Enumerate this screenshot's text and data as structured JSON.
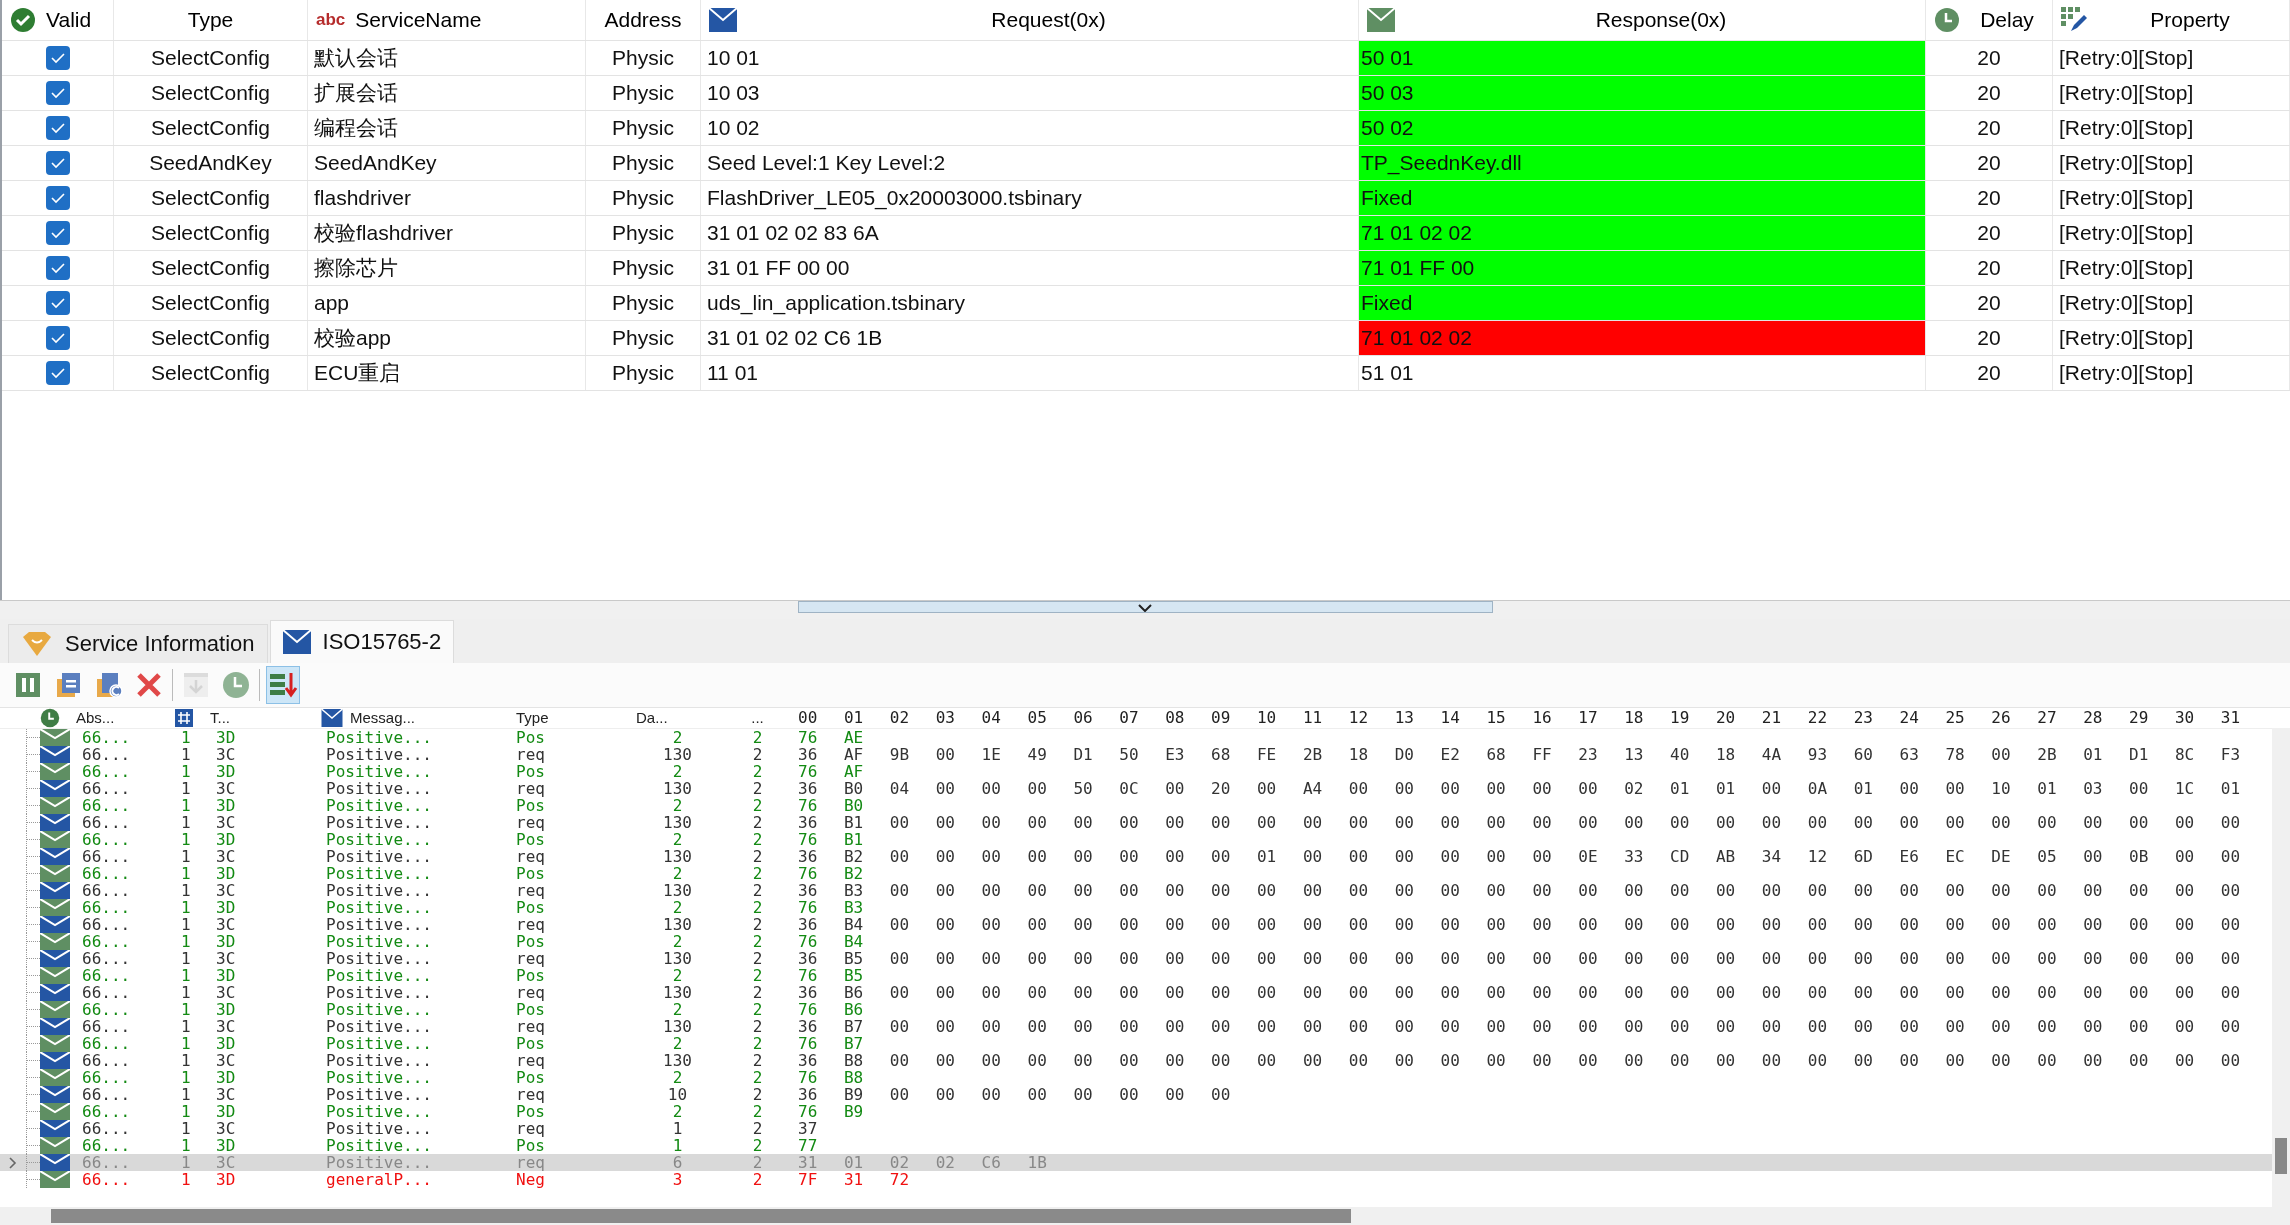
{
  "services": {
    "columns": [
      {
        "kind": "valid",
        "label": "Valid"
      },
      {
        "kind": "type",
        "label": "Type"
      },
      {
        "kind": "name",
        "label": "ServiceName",
        "icon_text": "abc"
      },
      {
        "kind": "address",
        "label": "Address"
      },
      {
        "kind": "request",
        "label": "Request(0x)"
      },
      {
        "kind": "response",
        "label": "Response(0x)"
      },
      {
        "kind": "delay",
        "label": "Delay"
      },
      {
        "kind": "property",
        "label": "Property"
      }
    ],
    "rows": [
      {
        "checked": true,
        "type": "SelectConfig",
        "name": "默认会话",
        "address": "Physic",
        "request": "10 01",
        "response": "50 01",
        "color": "#00ff00",
        "delay": "20",
        "property": "[Retry:0][Stop]"
      },
      {
        "checked": true,
        "type": "SelectConfig",
        "name": "扩展会话",
        "address": "Physic",
        "request": "10 03",
        "response": "50 03",
        "color": "#00ff00",
        "delay": "20",
        "property": "[Retry:0][Stop]"
      },
      {
        "checked": true,
        "type": "SelectConfig",
        "name": "编程会话",
        "address": "Physic",
        "request": "10 02",
        "response": "50 02",
        "color": "#00ff00",
        "delay": "20",
        "property": "[Retry:0][Stop]"
      },
      {
        "checked": true,
        "type": "SeedAndKey",
        "name": "SeedAndKey",
        "address": "Physic",
        "request": "Seed Level:1 Key Level:2",
        "response": "TP_SeednKey.dll",
        "color": "#00ff00",
        "delay": "20",
        "property": "[Retry:0][Stop]"
      },
      {
        "checked": true,
        "type": "SelectConfig",
        "name": "flashdriver",
        "address": "Physic",
        "request": "FlashDriver_LE05_0x20003000.tsbinary",
        "response": "Fixed",
        "color": "#00ff00",
        "delay": "20",
        "property": "[Retry:0][Stop]"
      },
      {
        "checked": true,
        "type": "SelectConfig",
        "name": "校验flashdriver",
        "address": "Physic",
        "request": "31 01 02 02 83 6A",
        "response": "71 01 02 02",
        "color": "#00ff00",
        "delay": "20",
        "property": "[Retry:0][Stop]"
      },
      {
        "checked": true,
        "type": "SelectConfig",
        "name": "擦除芯片",
        "address": "Physic",
        "request": "31 01 FF 00 00",
        "response": "71 01 FF 00",
        "color": "#00ff00",
        "delay": "20",
        "property": "[Retry:0][Stop]"
      },
      {
        "checked": true,
        "type": "SelectConfig",
        "name": "app",
        "address": "Physic",
        "request": "uds_lin_application.tsbinary",
        "response": "Fixed",
        "color": "#00ff00",
        "delay": "20",
        "property": "[Retry:0][Stop]"
      },
      {
        "checked": true,
        "type": "SelectConfig",
        "name": "校验app",
        "address": "Physic",
        "request": "31 01 02 02 C6 1B",
        "response": "71 01 02 02",
        "color": "#ff0000",
        "delay": "20",
        "property": "[Retry:0][Stop]"
      },
      {
        "checked": true,
        "type": "SelectConfig",
        "name": "ECU重启",
        "address": "Physic",
        "request": "11 01",
        "response": "51 01",
        "delay": "20",
        "property": "[Retry:0][Stop]"
      }
    ]
  },
  "tabs": [
    {
      "kind": "service",
      "label": "Service Information",
      "selected": false
    },
    {
      "kind": "protocol",
      "label": "ISO15765-2",
      "selected": true
    }
  ],
  "toolbar": [
    {
      "kind": "pause",
      "disabled": false,
      "on": false
    },
    {
      "kind": "copy",
      "disabled": false,
      "on": false
    },
    {
      "kind": "copy-c",
      "disabled": false,
      "on": false
    },
    {
      "kind": "delete",
      "disabled": false,
      "on": false
    },
    {
      "kind": "export",
      "disabled": true,
      "on": false
    },
    {
      "kind": "clock",
      "disabled": false,
      "on": false
    },
    {
      "kind": "autoscroll",
      "disabled": false,
      "on": true
    }
  ],
  "log": {
    "columns": [
      {
        "label": "Abs..."
      },
      {
        "label": "T..."
      },
      {
        "label": "Messag..."
      },
      {
        "label": "Type"
      },
      {
        "label": "Da..."
      },
      {
        "label": "..."
      },
      {
        "label": "00 01 02 03 04 05 06 07 08 09 10 11 12 13 14 15 16 17 18 19 20 21 22 23 24 25 26 27 28 29 30 31"
      }
    ],
    "rows": [
      {
        "kind": "pos",
        "selected": false,
        "abs": "66...",
        "ch": "1",
        "id": "3D",
        "msg": "Positive...",
        "type": "Pos",
        "dlc": "2",
        "len": "2",
        "data": "76 AE"
      },
      {
        "kind": "req",
        "selected": false,
        "abs": "66...",
        "ch": "1",
        "id": "3C",
        "msg": "Positive...",
        "type": "req",
        "dlc": "130",
        "len": "2",
        "data": "36 AF 9B 00 1E 49 D1 50 E3 68 FE 2B 18 D0 E2 68 FF 23 13 40 18 4A 93 60 63 78 00 2B 01 D1 8C F3"
      },
      {
        "kind": "pos",
        "selected": false,
        "abs": "66...",
        "ch": "1",
        "id": "3D",
        "msg": "Positive...",
        "type": "Pos",
        "dlc": "2",
        "len": "2",
        "data": "76 AF"
      },
      {
        "kind": "req",
        "selected": false,
        "abs": "66...",
        "ch": "1",
        "id": "3C",
        "msg": "Positive...",
        "type": "req",
        "dlc": "130",
        "len": "2",
        "data": "36 B0 04 00 00 00 50 0C 00 20 00 A4 00 00 00 00 00 00 02 01 01 00 0A 01 00 00 10 01 03 00 1C 01"
      },
      {
        "kind": "pos",
        "selected": false,
        "abs": "66...",
        "ch": "1",
        "id": "3D",
        "msg": "Positive...",
        "type": "Pos",
        "dlc": "2",
        "len": "2",
        "data": "76 B0"
      },
      {
        "kind": "req",
        "selected": false,
        "abs": "66...",
        "ch": "1",
        "id": "3C",
        "msg": "Positive...",
        "type": "req",
        "dlc": "130",
        "len": "2",
        "data": "36 B1 00 00 00 00 00 00 00 00 00 00 00 00 00 00 00 00 00 00 00 00 00 00 00 00 00 00 00 00 00 00"
      },
      {
        "kind": "pos",
        "selected": false,
        "abs": "66...",
        "ch": "1",
        "id": "3D",
        "msg": "Positive...",
        "type": "Pos",
        "dlc": "2",
        "len": "2",
        "data": "76 B1"
      },
      {
        "kind": "req",
        "selected": false,
        "abs": "66...",
        "ch": "1",
        "id": "3C",
        "msg": "Positive...",
        "type": "req",
        "dlc": "130",
        "len": "2",
        "data": "36 B2 00 00 00 00 00 00 00 00 01 00 00 00 00 00 00 0E 33 CD AB 34 12 6D E6 EC DE 05 00 0B 00 00"
      },
      {
        "kind": "pos",
        "selected": false,
        "abs": "66...",
        "ch": "1",
        "id": "3D",
        "msg": "Positive...",
        "type": "Pos",
        "dlc": "2",
        "len": "2",
        "data": "76 B2"
      },
      {
        "kind": "req",
        "selected": false,
        "abs": "66...",
        "ch": "1",
        "id": "3C",
        "msg": "Positive...",
        "type": "req",
        "dlc": "130",
        "len": "2",
        "data": "36 B3 00 00 00 00 00 00 00 00 00 00 00 00 00 00 00 00 00 00 00 00 00 00 00 00 00 00 00 00 00 00"
      },
      {
        "kind": "pos",
        "selected": false,
        "abs": "66...",
        "ch": "1",
        "id": "3D",
        "msg": "Positive...",
        "type": "Pos",
        "dlc": "2",
        "len": "2",
        "data": "76 B3"
      },
      {
        "kind": "req",
        "selected": false,
        "abs": "66...",
        "ch": "1",
        "id": "3C",
        "msg": "Positive...",
        "type": "req",
        "dlc": "130",
        "len": "2",
        "data": "36 B4 00 00 00 00 00 00 00 00 00 00 00 00 00 00 00 00 00 00 00 00 00 00 00 00 00 00 00 00 00 00"
      },
      {
        "kind": "pos",
        "selected": false,
        "abs": "66...",
        "ch": "1",
        "id": "3D",
        "msg": "Positive...",
        "type": "Pos",
        "dlc": "2",
        "len": "2",
        "data": "76 B4"
      },
      {
        "kind": "req",
        "selected": false,
        "abs": "66...",
        "ch": "1",
        "id": "3C",
        "msg": "Positive...",
        "type": "req",
        "dlc": "130",
        "len": "2",
        "data": "36 B5 00 00 00 00 00 00 00 00 00 00 00 00 00 00 00 00 00 00 00 00 00 00 00 00 00 00 00 00 00 00"
      },
      {
        "kind": "pos",
        "selected": false,
        "abs": "66...",
        "ch": "1",
        "id": "3D",
        "msg": "Positive...",
        "type": "Pos",
        "dlc": "2",
        "len": "2",
        "data": "76 B5"
      },
      {
        "kind": "req",
        "selected": false,
        "abs": "66...",
        "ch": "1",
        "id": "3C",
        "msg": "Positive...",
        "type": "req",
        "dlc": "130",
        "len": "2",
        "data": "36 B6 00 00 00 00 00 00 00 00 00 00 00 00 00 00 00 00 00 00 00 00 00 00 00 00 00 00 00 00 00 00"
      },
      {
        "kind": "pos",
        "selected": false,
        "abs": "66...",
        "ch": "1",
        "id": "3D",
        "msg": "Positive...",
        "type": "Pos",
        "dlc": "2",
        "len": "2",
        "data": "76 B6"
      },
      {
        "kind": "req",
        "selected": false,
        "abs": "66...",
        "ch": "1",
        "id": "3C",
        "msg": "Positive...",
        "type": "req",
        "dlc": "130",
        "len": "2",
        "data": "36 B7 00 00 00 00 00 00 00 00 00 00 00 00 00 00 00 00 00 00 00 00 00 00 00 00 00 00 00 00 00 00"
      },
      {
        "kind": "pos",
        "selected": false,
        "abs": "66...",
        "ch": "1",
        "id": "3D",
        "msg": "Positive...",
        "type": "Pos",
        "dlc": "2",
        "len": "2",
        "data": "76 B7"
      },
      {
        "kind": "req",
        "selected": false,
        "abs": "66...",
        "ch": "1",
        "id": "3C",
        "msg": "Positive...",
        "type": "req",
        "dlc": "130",
        "len": "2",
        "data": "36 B8 00 00 00 00 00 00 00 00 00 00 00 00 00 00 00 00 00 00 00 00 00 00 00 00 00 00 00 00 00 00"
      },
      {
        "kind": "pos",
        "selected": false,
        "abs": "66...",
        "ch": "1",
        "id": "3D",
        "msg": "Positive...",
        "type": "Pos",
        "dlc": "2",
        "len": "2",
        "data": "76 B8"
      },
      {
        "kind": "req",
        "selected": false,
        "abs": "66...",
        "ch": "1",
        "id": "3C",
        "msg": "Positive...",
        "type": "req",
        "dlc": "10",
        "len": "2",
        "data": "36 B9 00 00 00 00 00 00 00 00"
      },
      {
        "kind": "pos",
        "selected": false,
        "abs": "66...",
        "ch": "1",
        "id": "3D",
        "msg": "Positive...",
        "type": "Pos",
        "dlc": "2",
        "len": "2",
        "data": "76 B9"
      },
      {
        "kind": "req",
        "selected": false,
        "abs": "66...",
        "ch": "1",
        "id": "3C",
        "msg": "Positive...",
        "type": "req",
        "dlc": "1",
        "len": "2",
        "data": "37"
      },
      {
        "kind": "pos",
        "selected": false,
        "abs": "66...",
        "ch": "1",
        "id": "3D",
        "msg": "Positive...",
        "type": "Pos",
        "dlc": "1",
        "len": "2",
        "data": "77"
      },
      {
        "kind": "req",
        "selected": true,
        "abs": "66...",
        "ch": "1",
        "id": "3C",
        "msg": "Positive...",
        "type": "req",
        "dlc": "6",
        "len": "2",
        "data": "31 01 02 02 C6 1B"
      },
      {
        "kind": "neg",
        "selected": false,
        "abs": "66...",
        "ch": "1",
        "id": "3D",
        "msg": "generalP...",
        "type": "Neg",
        "dlc": "3",
        "len": "2",
        "data": "7F 31 72"
      }
    ]
  }
}
